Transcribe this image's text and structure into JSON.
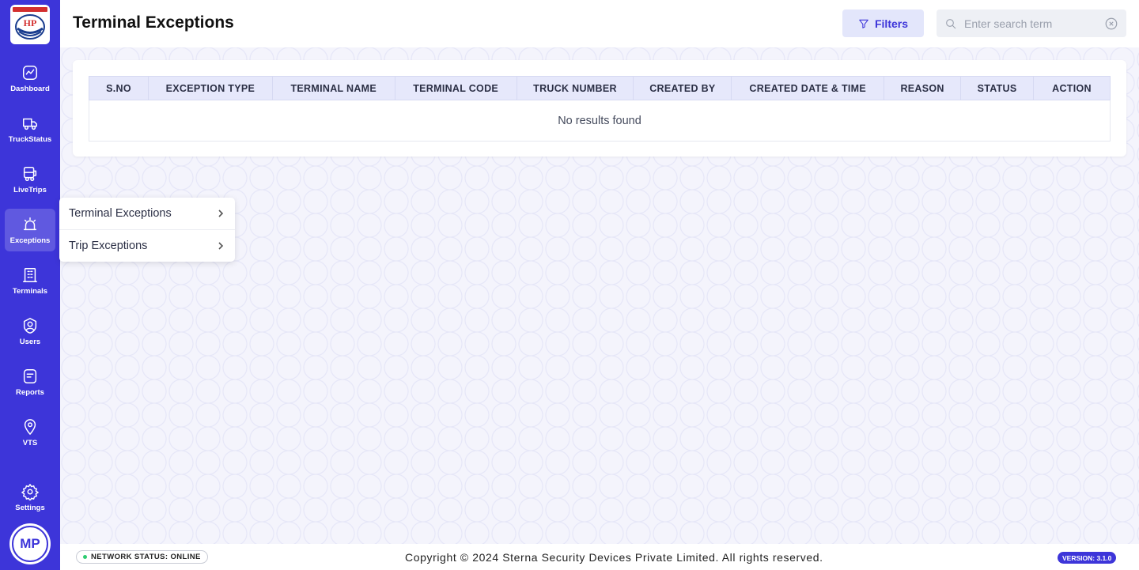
{
  "app": {
    "logo_text": "HP"
  },
  "sidebar": {
    "items": [
      {
        "label": "Dashboard",
        "icon": "chart-icon"
      },
      {
        "label": "TruckStatus",
        "icon": "truck-icon"
      },
      {
        "label": "LiveTrips",
        "icon": "bus-icon"
      },
      {
        "label": "Exceptions",
        "icon": "alarm-icon",
        "active": true
      },
      {
        "label": "Terminals",
        "icon": "building-icon"
      },
      {
        "label": "Users",
        "icon": "user-icon"
      },
      {
        "label": "Reports",
        "icon": "report-icon"
      },
      {
        "label": "VTS",
        "icon": "location-pin-icon"
      }
    ],
    "settings_label": "Settings",
    "avatar_initials": "MP"
  },
  "header": {
    "title": "Terminal Exceptions",
    "filters_label": "Filters",
    "search_placeholder": "Enter search term"
  },
  "submenu": {
    "items": [
      {
        "label": "Terminal Exceptions"
      },
      {
        "label": "Trip Exceptions"
      }
    ]
  },
  "table": {
    "columns": [
      "S.NO",
      "EXCEPTION TYPE",
      "TERMINAL NAME",
      "TERMINAL CODE",
      "TRUCK NUMBER",
      "CREATED BY",
      "CREATED DATE & TIME",
      "REASON",
      "STATUS",
      "ACTION"
    ],
    "empty_message": "No results found"
  },
  "footer": {
    "network_status": "NETWORK STATUS: ONLINE",
    "copyright": "Copyright © 2024 Sterna Security Devices Private Limited. All rights reserved.",
    "version": "VERSION: 3.1.0"
  },
  "colors": {
    "primary": "#3d35d9",
    "online": "#2ecc71"
  }
}
